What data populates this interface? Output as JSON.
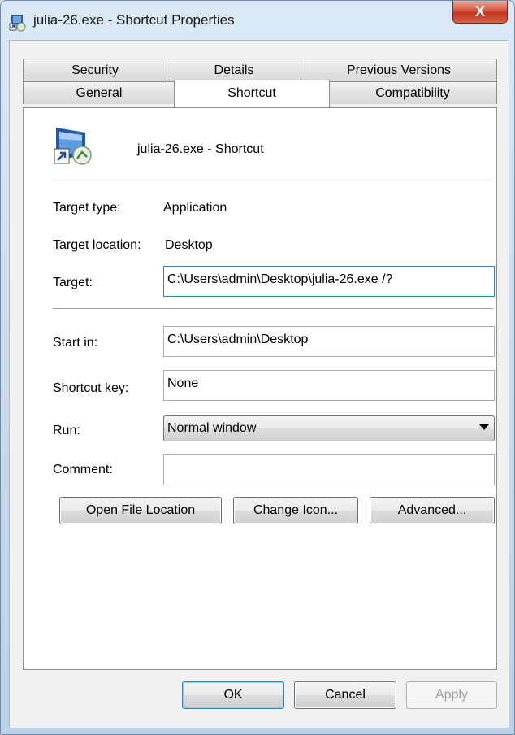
{
  "window": {
    "title": "julia-26.exe - Shortcut Properties",
    "close_label": "X"
  },
  "tabs": {
    "row1": [
      "Security",
      "Details",
      "Previous Versions"
    ],
    "row2": [
      "General",
      "Shortcut",
      "Compatibility"
    ],
    "active": "Shortcut"
  },
  "shortcut": {
    "name": "julia-26.exe - Shortcut",
    "icon": "exe-file-shortcut-icon"
  },
  "fields": {
    "target_type_label": "Target type:",
    "target_type_value": "Application",
    "target_location_label": "Target location:",
    "target_location_value": "Desktop",
    "target_label": "Target:",
    "target_value": "C:\\Users\\admin\\Desktop\\julia-26.exe /?",
    "start_in_label": "Start in:",
    "start_in_value": "C:\\Users\\admin\\Desktop",
    "shortcut_key_label": "Shortcut key:",
    "shortcut_key_value": "None",
    "run_label": "Run:",
    "run_value": "Normal window",
    "comment_label": "Comment:",
    "comment_value": ""
  },
  "buttons": {
    "open_file_location": "Open File Location",
    "change_icon": "Change Icon...",
    "advanced": "Advanced...",
    "ok": "OK",
    "cancel": "Cancel",
    "apply": "Apply"
  }
}
